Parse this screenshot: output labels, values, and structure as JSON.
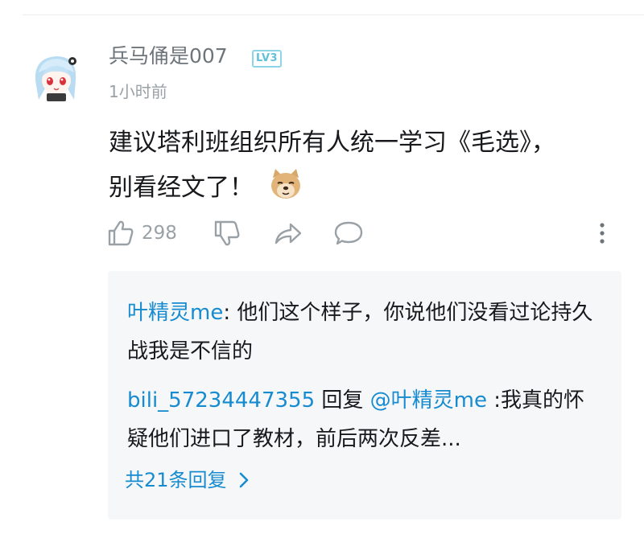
{
  "comment": {
    "username": "兵马俑是007",
    "level": "LV3",
    "time": "1小时前",
    "content_line1": "建议塔利班组织所有人统一学习《毛选》，",
    "content_line2": "别看经文了！",
    "like_count": "298"
  },
  "icons": {
    "avatar": "anime-avatar",
    "emoji": "doge-emoji",
    "like": "thumbs-up-icon",
    "dislike": "thumbs-down-icon",
    "share": "share-arrow-icon",
    "reply": "comment-bubble-icon",
    "more": "more-vertical-icon",
    "see_more": "chevron-right-icon"
  },
  "replies": {
    "items": [
      {
        "name": "叶精灵me",
        "separator": ": ",
        "text": "他们这个样子，你说他们没看过论持久战我是不信的"
      },
      {
        "name": "bili_57234447355",
        "reply_word": " 回复 ",
        "mention": "@叶精灵me",
        "text": " :我真的怀疑他们进口了教材，前后两次反差..."
      }
    ],
    "see_more": "共21条回复"
  },
  "colors": {
    "link_blue": "#178bcf",
    "text_primary": "#18191c",
    "text_secondary": "#9aa1a6",
    "reply_bg": "#f6f7f8",
    "level_badge": "#5fc1da"
  }
}
